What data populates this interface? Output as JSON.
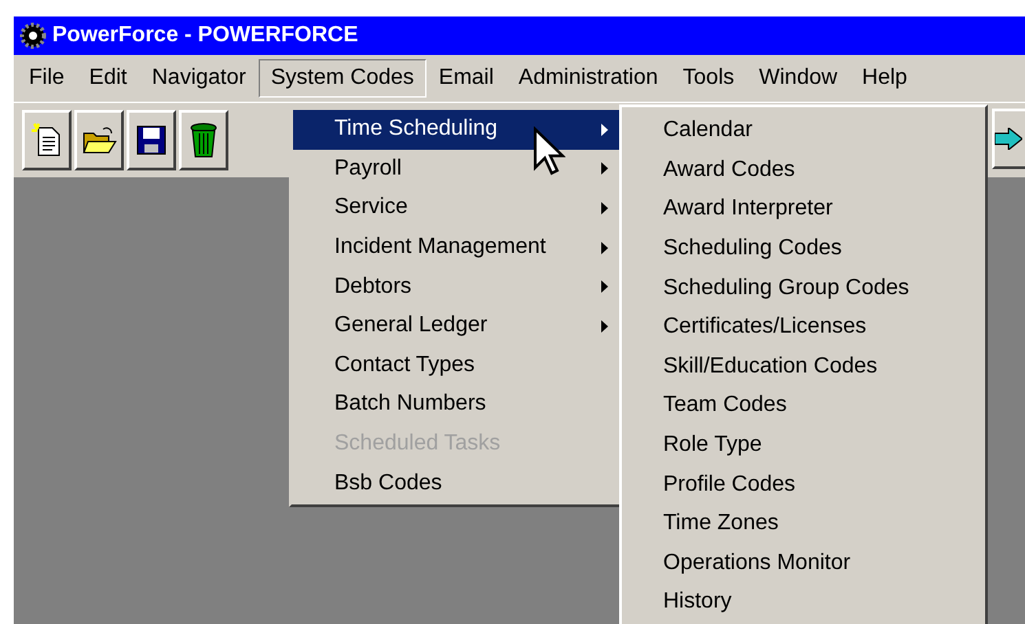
{
  "window": {
    "title": "PowerForce - POWERFORCE"
  },
  "menu_bar": [
    {
      "label": "File",
      "selected": false
    },
    {
      "label": "Edit",
      "selected": false
    },
    {
      "label": "Navigator",
      "selected": false
    },
    {
      "label": "System Codes",
      "selected": true
    },
    {
      "label": "Email",
      "selected": false
    },
    {
      "label": "Administration",
      "selected": false
    },
    {
      "label": "Tools",
      "selected": false
    },
    {
      "label": "Window",
      "selected": false
    },
    {
      "label": "Help",
      "selected": false
    }
  ],
  "system_codes_menu": [
    {
      "label": "Time Scheduling",
      "kind": "submenu",
      "selected": true,
      "disabled": false
    },
    {
      "label": "Payroll",
      "kind": "submenu",
      "selected": false,
      "disabled": false
    },
    {
      "label": "Service",
      "kind": "submenu",
      "selected": false,
      "disabled": false
    },
    {
      "label": "Incident Management",
      "kind": "submenu",
      "selected": false,
      "disabled": false
    },
    {
      "label": "Debtors",
      "kind": "submenu",
      "selected": false,
      "disabled": false
    },
    {
      "label": "General Ledger",
      "kind": "submenu",
      "selected": false,
      "disabled": false
    },
    {
      "label": "Contact Types",
      "kind": "command",
      "selected": false,
      "disabled": false
    },
    {
      "label": "Batch Numbers",
      "kind": "command",
      "selected": false,
      "disabled": false
    },
    {
      "label": "Scheduled Tasks",
      "kind": "command",
      "selected": false,
      "disabled": true
    },
    {
      "label": "Bsb Codes",
      "kind": "command",
      "selected": false,
      "disabled": false
    }
  ],
  "time_scheduling_menu": [
    "Calendar",
    "Award Codes",
    "Award Interpreter",
    "Scheduling Codes",
    "Scheduling Group Codes",
    "Certificates/Licenses",
    "Skill/Education Codes",
    "Team Codes",
    "Role Type",
    "Profile Codes",
    "Time Zones",
    "Operations Monitor",
    "History"
  ]
}
